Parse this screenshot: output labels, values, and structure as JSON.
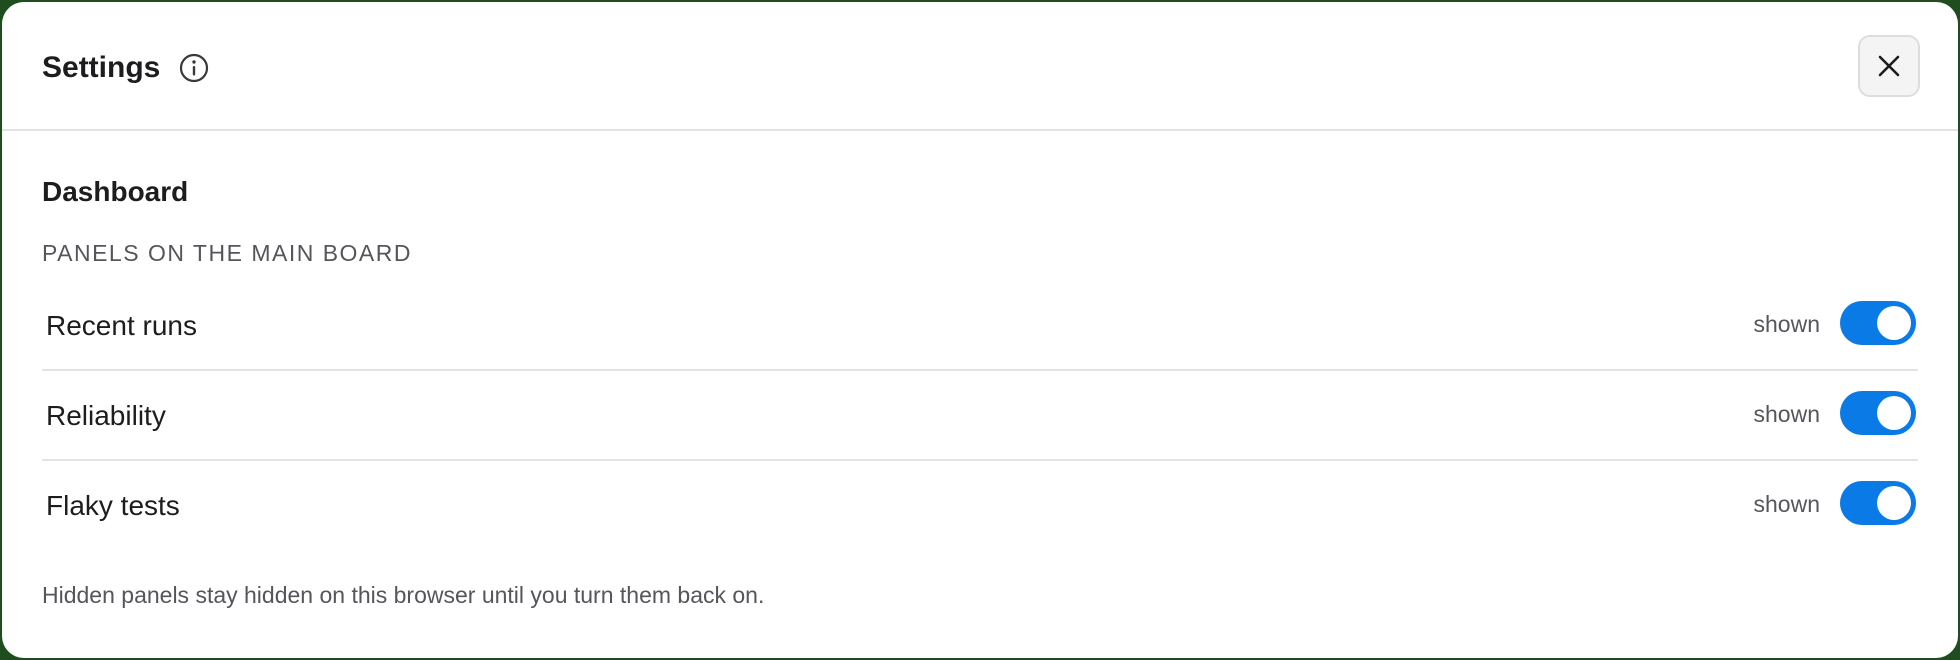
{
  "dialog": {
    "title": "Settings",
    "info_icon": "info-circle-icon",
    "close_icon": "close-x-icon"
  },
  "section": {
    "title": "Dashboard",
    "subtitle": "PANELS ON THE MAIN BOARD"
  },
  "panels": [
    {
      "label": "Recent runs",
      "state": "shown",
      "enabled": true
    },
    {
      "label": "Reliability",
      "state": "shown",
      "enabled": true
    },
    {
      "label": "Flaky tests",
      "state": "shown",
      "enabled": true
    }
  ],
  "footer_note": "Hidden panels stay hidden on this browser until you turn them back on.",
  "colors": {
    "accent": "#0a7ae6",
    "text_primary": "#1d1d1f",
    "text_secondary": "#55555c",
    "divider": "#e3e3e3",
    "background": "#1f4d1f"
  }
}
